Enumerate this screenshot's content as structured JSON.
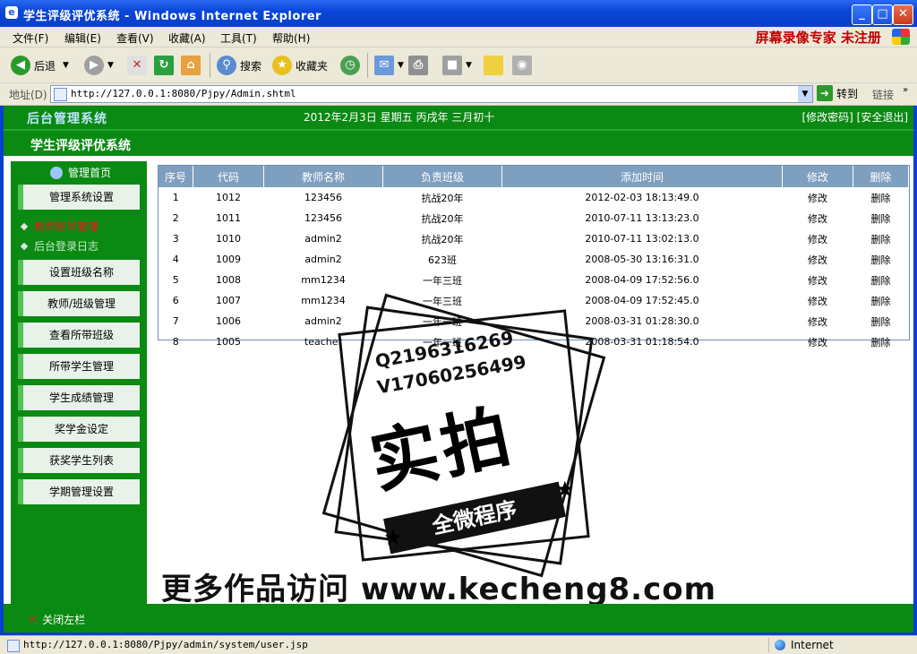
{
  "window": {
    "title": "学生评级评优系统 - Windows Internet Explorer"
  },
  "menu": {
    "items": [
      "文件(F)",
      "编辑(E)",
      "查看(V)",
      "收藏(A)",
      "工具(T)",
      "帮助(H)"
    ],
    "brand": "屏幕录像专家 未注册"
  },
  "toolbar": {
    "back_label": "后退",
    "search_label": "搜索",
    "favorites_label": "收藏夹"
  },
  "address": {
    "label": "地址(D)",
    "url": "http://127.0.0.1:8080/Pjpy/Admin.shtml",
    "go_label": "转到",
    "links_label": "链接"
  },
  "header": {
    "logo": "后台管理系统",
    "date": "2012年2月3日 星期五 丙戌年 三月初十",
    "links": "[修改密码] [安全退出]",
    "sysname": "学生评级评优系统"
  },
  "sidebar": {
    "home": "管理首页",
    "btn_settings": "管理系统设置",
    "sub_user": "教师账号管理",
    "sub_log": "后台登录日志",
    "buttons": [
      "设置班级名称",
      "教师/班级管理",
      "查看所带班级",
      "所带学生管理",
      "学生成绩管理",
      "奖学金设定",
      "获奖学生列表",
      "学期管理设置"
    ]
  },
  "table": {
    "headers": [
      "序号",
      "代码",
      "教师名称",
      "负责班级",
      "添加时间",
      "修改",
      "删除"
    ],
    "edit_label": "修改",
    "delete_label": "删除",
    "rows": [
      [
        "1",
        "1012",
        "123456",
        "抗战20年",
        "2012-02-03 18:13:49.0"
      ],
      [
        "2",
        "1011",
        "123456",
        "抗战20年",
        "2010-07-11 13:13:23.0"
      ],
      [
        "3",
        "1010",
        "admin2",
        "抗战20年",
        "2010-07-11 13:02:13.0"
      ],
      [
        "4",
        "1009",
        "admin2",
        "623班",
        "2008-05-30 13:16:31.0"
      ],
      [
        "5",
        "1008",
        "mm1234",
        "一年三班",
        "2008-04-09 17:52:56.0"
      ],
      [
        "6",
        "1007",
        "mm1234",
        "一年三班",
        "2008-04-09 17:52:45.0"
      ],
      [
        "7",
        "1006",
        "admin2",
        "一年一班",
        "2008-03-31 01:28:30.0"
      ],
      [
        "8",
        "1005",
        "teacher",
        "一年一班",
        "2008-03-31 01:18:54.0"
      ]
    ]
  },
  "footer": {
    "close_sidebar": "关闭左栏"
  },
  "watermark": {
    "line1": "Q2196316269",
    "line2": "V17060256499",
    "big": "实拍",
    "ribbon": "全微程序",
    "site": "更多作品访问 www.kecheng8.com"
  },
  "status": {
    "url": "http://127.0.0.1:8080/Pjpy/admin/system/user.jsp",
    "zone": "Internet"
  }
}
